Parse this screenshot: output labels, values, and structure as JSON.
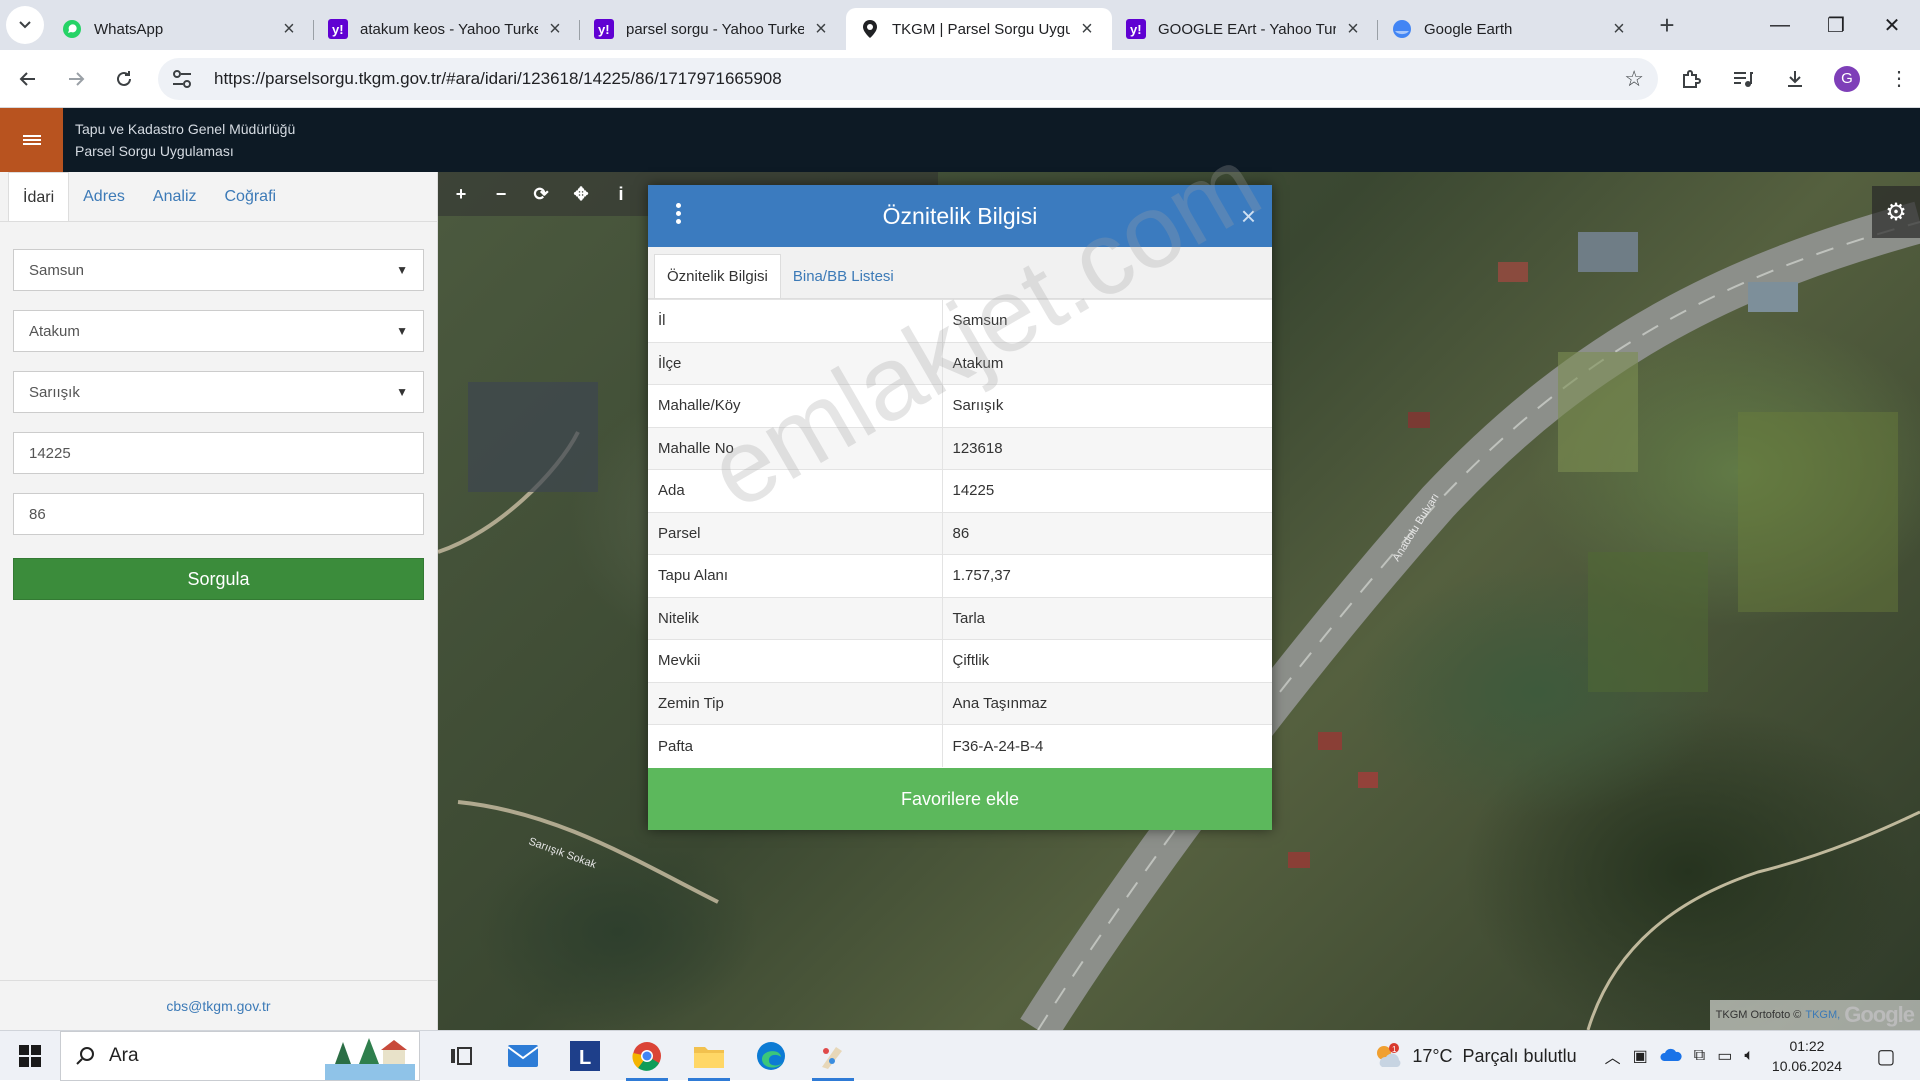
{
  "browser": {
    "tabs": [
      {
        "title": "WhatsApp",
        "icon": "whatsapp-icon",
        "active": false
      },
      {
        "title": "atakum keos - Yahoo Turkey",
        "icon": "yahoo-icon",
        "active": false
      },
      {
        "title": "parsel sorgu - Yahoo Turkey",
        "icon": "yahoo-icon",
        "active": false
      },
      {
        "title": "TKGM | Parsel Sorgu Uygulaması",
        "icon": "location-pin-icon",
        "active": true
      },
      {
        "title": "GOOGLE EArt - Yahoo Turkey",
        "icon": "yahoo-icon",
        "active": false
      },
      {
        "title": "Google Earth",
        "icon": "google-earth-icon",
        "active": false
      }
    ],
    "url": "https://parselsorgu.tkgm.gov.tr/#ara/idari/123618/14225/86/1717971665908",
    "profile_initial": "G"
  },
  "app": {
    "title_line1": "Tapu ve Kadastro Genel Müdürlüğü",
    "title_line2": "Parsel Sorgu Uygulaması"
  },
  "left_panel": {
    "tabs": [
      "İdari",
      "Adres",
      "Analiz",
      "Coğrafi"
    ],
    "active_tab": "İdari",
    "province": "Samsun",
    "district": "Atakum",
    "neighborhood": "Sarıışık",
    "block": "14225",
    "parcel": "86",
    "query_button": "Sorgula",
    "footer_email": "cbs@tkgm.gov.tr"
  },
  "modal": {
    "title": "Öznitelik Bilgisi",
    "tabs": [
      "Öznitelik Bilgisi",
      "Bina/BB Listesi"
    ],
    "active_tab": "Öznitelik Bilgisi",
    "rows": [
      {
        "label": "İl",
        "value": "Samsun"
      },
      {
        "label": "İlçe",
        "value": "Atakum"
      },
      {
        "label": "Mahalle/Köy",
        "value": "Sarıışık"
      },
      {
        "label": "Mahalle No",
        "value": "123618"
      },
      {
        "label": "Ada",
        "value": "14225"
      },
      {
        "label": "Parsel",
        "value": "86"
      },
      {
        "label": "Tapu Alanı",
        "value": "1.757,37"
      },
      {
        "label": "Nitelik",
        "value": "Tarla"
      },
      {
        "label": "Mevkii",
        "value": "Çiftlik"
      },
      {
        "label": "Zemin Tip",
        "value": "Ana Taşınmaz"
      },
      {
        "label": "Pafta",
        "value": "F36-A-24-B-4"
      }
    ],
    "favorite_button": "Favorilere ekle",
    "watermark": "emlakjet.com"
  },
  "map": {
    "road_label_1": "Anadolu Bulvarı",
    "road_label_2": "Sarıışık Sokak",
    "attribution_text": "TKGM Ortofoto ©",
    "attribution_link": "TKGM,",
    "attribution_brand": "Google"
  },
  "taskbar": {
    "search_placeholder": "Ara",
    "weather_temp": "17°C",
    "weather_text": "Parçalı bulutlu",
    "weather_badge": "1",
    "time": "01:22",
    "date": "10.06.2024"
  }
}
